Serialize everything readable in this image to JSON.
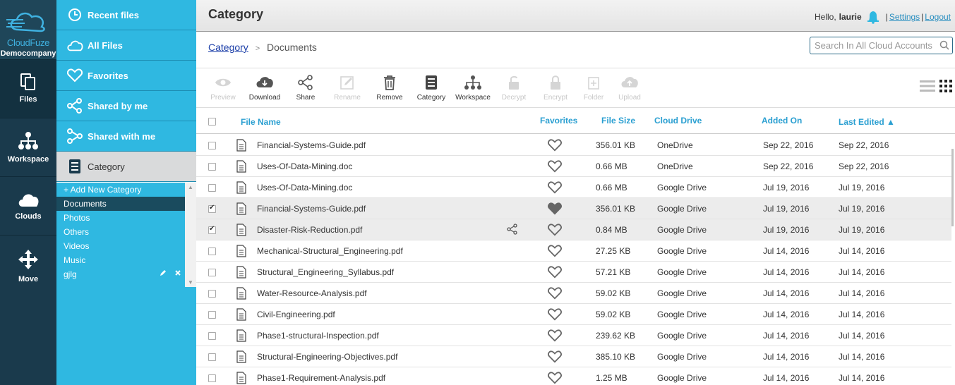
{
  "brand": {
    "name": "CloudFuze",
    "company": "Democompany"
  },
  "rail": [
    {
      "id": "files",
      "label": "Files",
      "icon": "files-icon"
    },
    {
      "id": "workspace",
      "label": "Workspace",
      "icon": "workspace-icon"
    },
    {
      "id": "clouds",
      "label": "Clouds",
      "icon": "cloud-icon"
    },
    {
      "id": "move",
      "label": "Move",
      "icon": "move-icon"
    }
  ],
  "nav": {
    "items": [
      {
        "label": "Recent files",
        "icon": "clock-icon"
      },
      {
        "label": "All Files",
        "icon": "cloud-outline-icon"
      },
      {
        "label": "Favorites",
        "icon": "heart-icon"
      },
      {
        "label": "Shared by me",
        "icon": "share-icon"
      },
      {
        "label": "Shared with me",
        "icon": "share-with-icon"
      },
      {
        "label": "Category",
        "icon": "cabinet-icon"
      }
    ],
    "categories": {
      "add_label": "+ Add New Category",
      "items": [
        "Documents",
        "Photos",
        "Others",
        "Videos",
        "Music",
        "gjlg"
      ],
      "active": "Documents"
    }
  },
  "header": {
    "title": "Category",
    "greeting": "Hello,",
    "user": "laurie",
    "settings": "Settings",
    "logout": "Logout",
    "separator": "|"
  },
  "breadcrumb": {
    "root": "Category",
    "current": "Documents",
    "sep": ">"
  },
  "search": {
    "placeholder": "Search In All Cloud Accounts"
  },
  "toolbar": {
    "preview": "Preview",
    "download": "Download",
    "share": "Share",
    "rename": "Rename",
    "remove": "Remove",
    "category": "Category",
    "workspace": "Workspace",
    "decrypt": "Decrypt",
    "encrypt": "Encrypt",
    "folder": "Folder",
    "upload": "Upload"
  },
  "table": {
    "headers": {
      "file_name": "File Name",
      "favorites": "Favorites",
      "file_size": "File Size",
      "cloud_drive": "Cloud Drive",
      "added_on": "Added On",
      "last_edited": "Last Edited ▲"
    },
    "rows": [
      {
        "name": "Financial-Systems-Guide.pdf",
        "size": "356.01 KB",
        "drive": "OneDrive",
        "added": "Sep 22, 2016",
        "edited": "Sep 22, 2016",
        "checked": false,
        "fav": false,
        "shared": false
      },
      {
        "name": "Uses-Of-Data-Mining.doc",
        "size": "0.66 MB",
        "drive": "OneDrive",
        "added": "Sep 22, 2016",
        "edited": "Sep 22, 2016",
        "checked": false,
        "fav": false,
        "shared": false
      },
      {
        "name": "Uses-Of-Data-Mining.doc",
        "size": "0.66 MB",
        "drive": "Google Drive",
        "added": "Jul 19, 2016",
        "edited": "Jul 19, 2016",
        "checked": false,
        "fav": false,
        "shared": false
      },
      {
        "name": "Financial-Systems-Guide.pdf",
        "size": "356.01 KB",
        "drive": "Google Drive",
        "added": "Jul 19, 2016",
        "edited": "Jul 19, 2016",
        "checked": true,
        "fav": true,
        "shared": false
      },
      {
        "name": "Disaster-Risk-Reduction.pdf",
        "size": "0.84 MB",
        "drive": "Google Drive",
        "added": "Jul 19, 2016",
        "edited": "Jul 19, 2016",
        "checked": true,
        "fav": false,
        "shared": true
      },
      {
        "name": "Mechanical-Structural_Engineering.pdf",
        "size": "27.25 KB",
        "drive": "Google Drive",
        "added": "Jul 14, 2016",
        "edited": "Jul 14, 2016",
        "checked": false,
        "fav": false,
        "shared": false
      },
      {
        "name": "Structural_Engineering_Syllabus.pdf",
        "size": "57.21 KB",
        "drive": "Google Drive",
        "added": "Jul 14, 2016",
        "edited": "Jul 14, 2016",
        "checked": false,
        "fav": false,
        "shared": false
      },
      {
        "name": "Water-Resource-Analysis.pdf",
        "size": "59.02 KB",
        "drive": "Google Drive",
        "added": "Jul 14, 2016",
        "edited": "Jul 14, 2016",
        "checked": false,
        "fav": false,
        "shared": false
      },
      {
        "name": "Civil-Engineering.pdf",
        "size": "59.02 KB",
        "drive": "Google Drive",
        "added": "Jul 14, 2016",
        "edited": "Jul 14, 2016",
        "checked": false,
        "fav": false,
        "shared": false
      },
      {
        "name": "Phase1-structural-Inspection.pdf",
        "size": "239.62 KB",
        "drive": "Google Drive",
        "added": "Jul 14, 2016",
        "edited": "Jul 14, 2016",
        "checked": false,
        "fav": false,
        "shared": false
      },
      {
        "name": "Structural-Engineering-Objectives.pdf",
        "size": "385.10 KB",
        "drive": "Google Drive",
        "added": "Jul 14, 2016",
        "edited": "Jul 14, 2016",
        "checked": false,
        "fav": false,
        "shared": false
      },
      {
        "name": "Phase1-Requirement-Analysis.pdf",
        "size": "1.25 MB",
        "drive": "Google Drive",
        "added": "Jul 14, 2016",
        "edited": "Jul 14, 2016",
        "checked": false,
        "fav": false,
        "shared": false
      }
    ]
  },
  "colors": {
    "rail": "#1a3a4c",
    "nav": "#2fb8e1",
    "accent": "#2a9fd1"
  }
}
